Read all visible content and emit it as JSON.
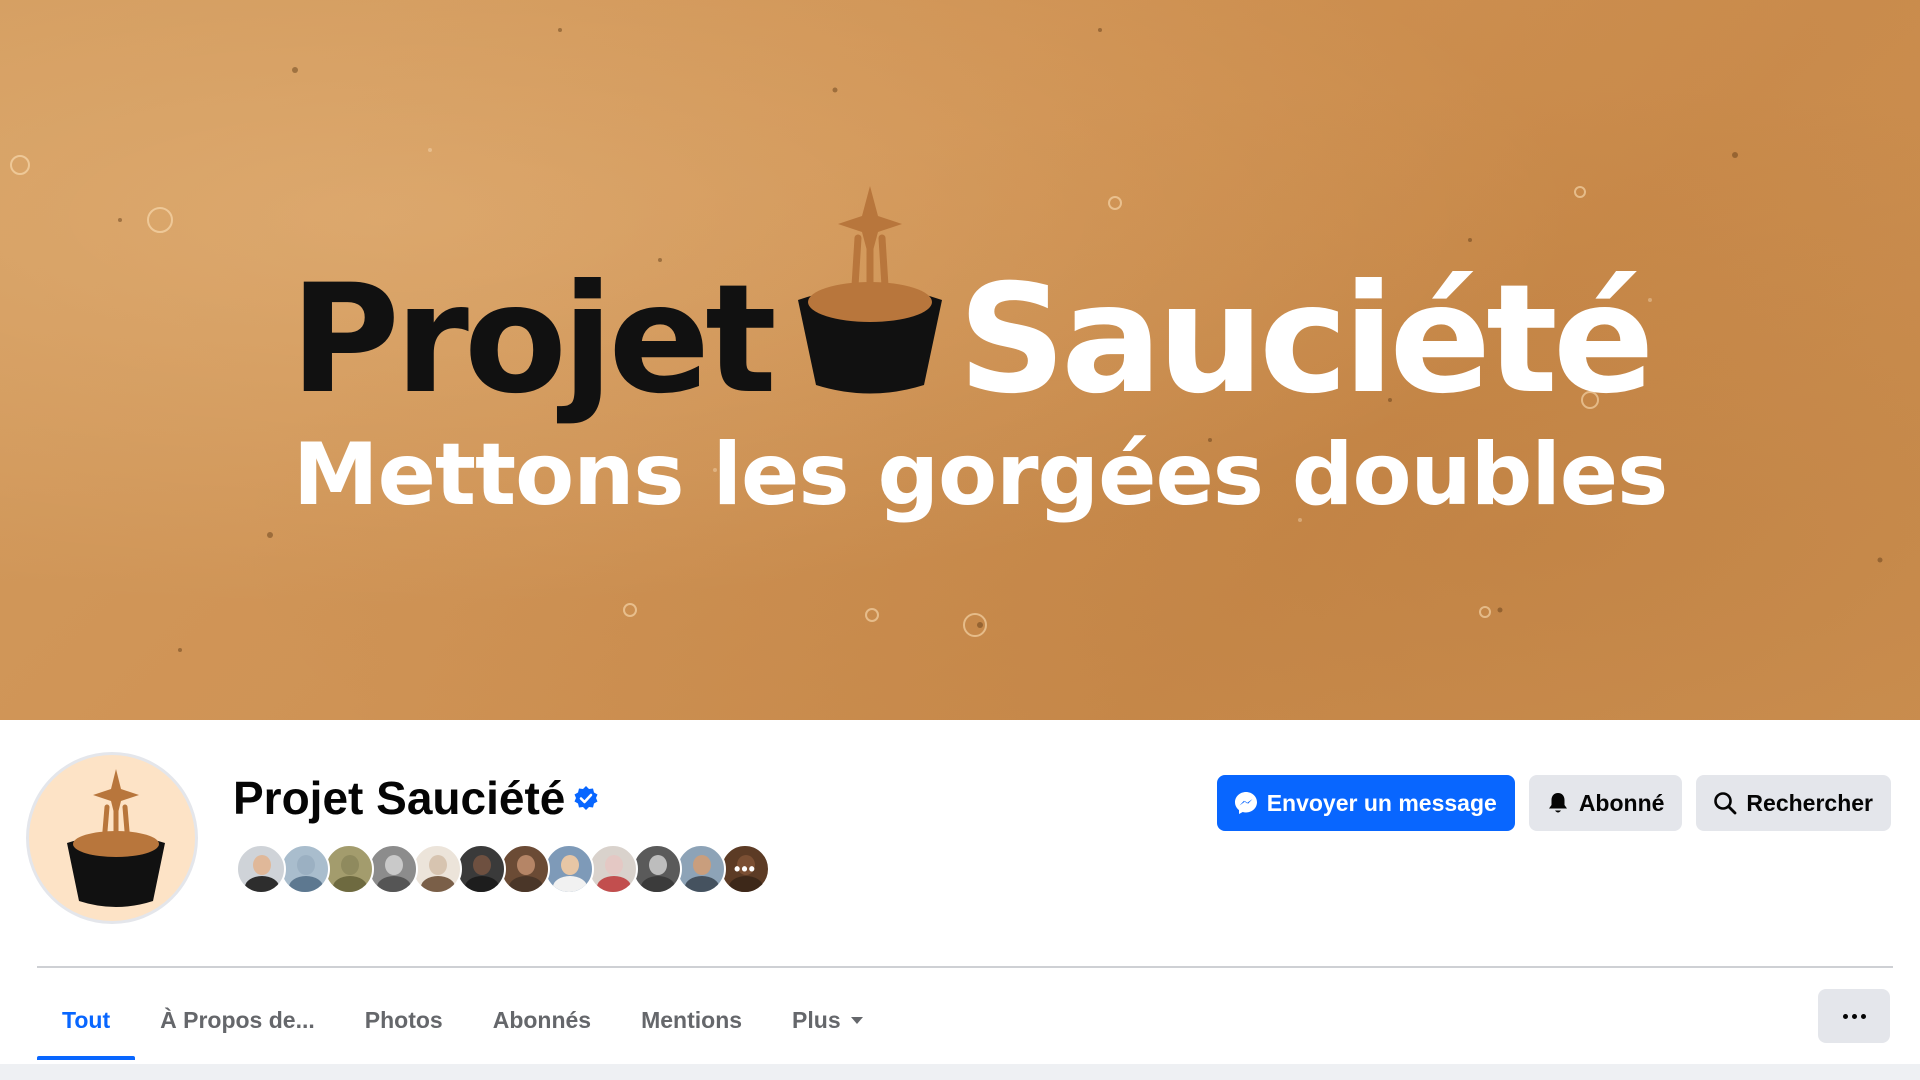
{
  "cover": {
    "logo_word_1": "Projet",
    "logo_word_2": "Sauciété",
    "tagline": "Mettons les gorgées doubles",
    "background_color": "#cf9355",
    "logo_dark_color": "#111111",
    "logo_accent_color": "#b8763c"
  },
  "page": {
    "name": "Projet Sauciété",
    "verified_icon": "verified-badge-icon",
    "avatar_icon": "sauce-pot-logo"
  },
  "followers": {
    "avatars": [
      {
        "skin": "#e0b899",
        "shirt": "#2d2d2d",
        "bg": "#cfd3d8"
      },
      {
        "skin": "#9bb0c2",
        "shirt": "#5d7890",
        "bg": "#a9bdcd"
      },
      {
        "skin": "#8f8a5e",
        "shirt": "#6e6a40",
        "bg": "#a39c6d"
      },
      {
        "skin": "#c9c9c9",
        "shirt": "#555555",
        "bg": "#8c8c8c"
      },
      {
        "skin": "#d7c4b0",
        "shirt": "#7a5f48",
        "bg": "#ece4da"
      },
      {
        "skin": "#6e5040",
        "shirt": "#1d1d1d",
        "bg": "#3a3a3a"
      },
      {
        "skin": "#b58566",
        "shirt": "#4a3628",
        "bg": "#6b4b35"
      },
      {
        "skin": "#e7c6a5",
        "shirt": "#f1f1f1",
        "bg": "#7e9ab8"
      },
      {
        "skin": "#e4c8c4",
        "shirt": "#c24e4e",
        "bg": "#d9d2cc"
      },
      {
        "skin": "#bdbdbd",
        "shirt": "#3b3b3b",
        "bg": "#5a5a5a"
      },
      {
        "skin": "#c99e7d",
        "shirt": "#45525f",
        "bg": "#8da3b7"
      },
      {
        "skin": "#7b4f33",
        "shirt": "#3d2819",
        "bg": "#5c3b25",
        "more": "•••"
      }
    ]
  },
  "actions": {
    "message_label": "Envoyer un message",
    "message_icon": "messenger-icon",
    "follow_label": "Abonné",
    "follow_icon": "bell-icon",
    "search_label": "Rechercher",
    "search_icon": "search-icon",
    "primary_color": "#0866ff",
    "secondary_color": "#e4e6eb"
  },
  "tabs": [
    {
      "label": "Tout",
      "active": true
    },
    {
      "label": "À Propos de...",
      "active": false
    },
    {
      "label": "Photos",
      "active": false
    },
    {
      "label": "Abonnés",
      "active": false
    },
    {
      "label": "Mentions",
      "active": false
    },
    {
      "label": "Plus",
      "active": false,
      "dropdown": true
    }
  ],
  "more_options_icon": "more-horizontal-icon"
}
